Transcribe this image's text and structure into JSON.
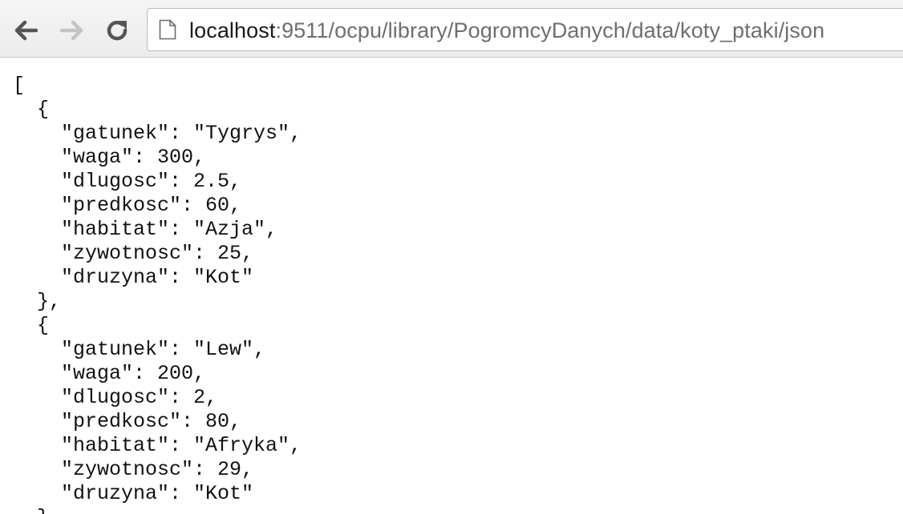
{
  "browser": {
    "back_icon": "arrow-left-icon",
    "forward_icon": "arrow-right-icon",
    "reload_icon": "reload-icon",
    "page_icon": "document-icon",
    "url_host": "localhost",
    "url_rest": ":9511/ocpu/library/PogromcyDanych/data/koty_ptaki/json"
  },
  "json_lines": [
    "[",
    "  {",
    "    \"gatunek\": \"Tygrys\",",
    "    \"waga\": 300,",
    "    \"dlugosc\": 2.5,",
    "    \"predkosc\": 60,",
    "    \"habitat\": \"Azja\",",
    "    \"zywotnosc\": 25,",
    "    \"druzyna\": \"Kot\"",
    "  },",
    "  {",
    "    \"gatunek\": \"Lew\",",
    "    \"waga\": 200,",
    "    \"dlugosc\": 2,",
    "    \"predkosc\": 80,",
    "    \"habitat\": \"Afryka\",",
    "    \"zywotnosc\": 29,",
    "    \"druzyna\": \"Kot\"",
    "  },"
  ]
}
